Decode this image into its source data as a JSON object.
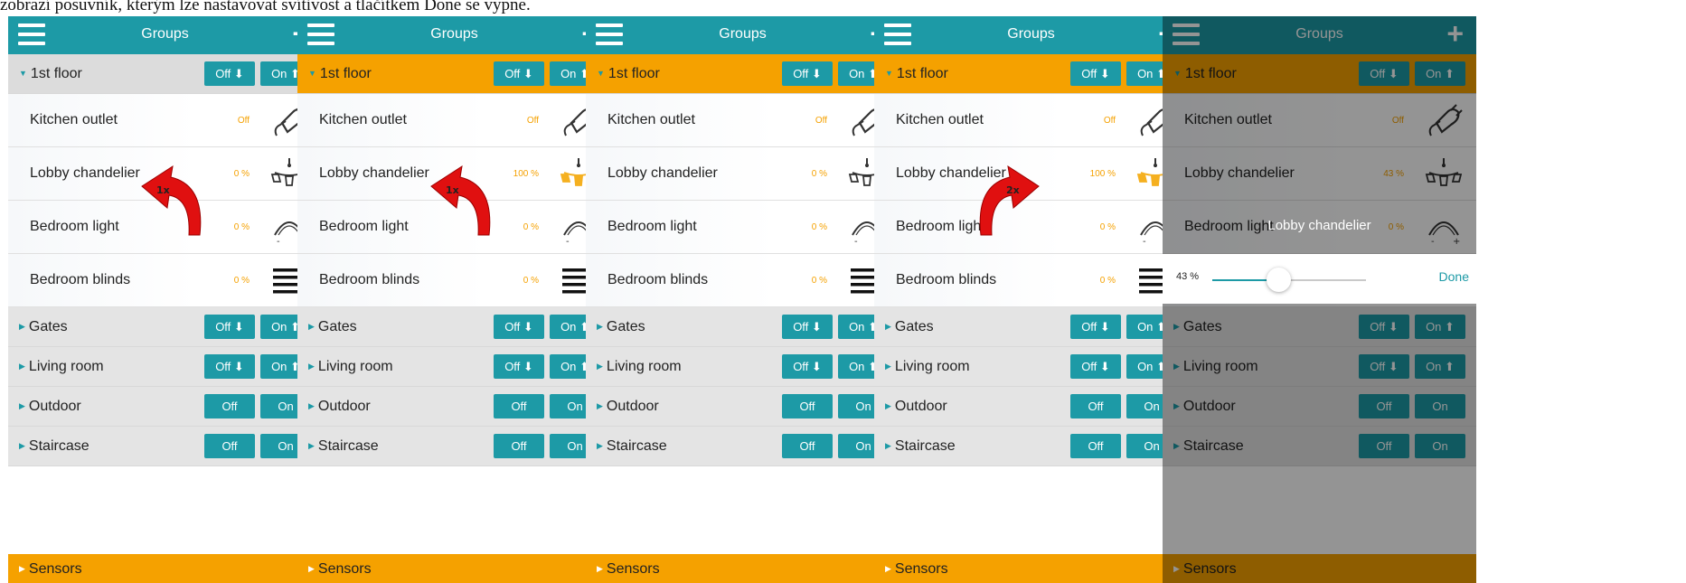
{
  "caption": "zobrazí posuvník, kterým lze nastavovat svítivost a tlačítkem Done se vypne.",
  "header": {
    "title": "Groups"
  },
  "colors": {
    "teal": "#1d9aa6",
    "orange": "#f5a100",
    "grey": "#e4e4e4"
  },
  "groups": {
    "first_floor": "1st floor",
    "gates": "Gates",
    "living_room": "Living room",
    "outdoor": "Outdoor",
    "staircase": "Staircase",
    "sensors": "Sensors"
  },
  "buttons": {
    "off_arrow": "Off ⬇",
    "on_arrow": "On ⬆",
    "off": "Off",
    "on": "On"
  },
  "devices": {
    "kitchen_outlet": "Kitchen outlet",
    "lobby_chandelier": "Lobby chandelier",
    "bedroom_light": "Bedroom light",
    "bedroom_blinds": "Bedroom blinds"
  },
  "panels": [
    {
      "kitchen": "Off",
      "lobby": "0 %",
      "bedroom_light": "0 %",
      "blinds": "0 %",
      "gesture": "1x",
      "lobby_level": 0
    },
    {
      "kitchen": "Off",
      "lobby": "100 %",
      "bedroom_light": "0 %",
      "blinds": "0 %",
      "gesture": "1x",
      "lobby_level": 1
    },
    {
      "kitchen": "Off",
      "lobby": "0 %",
      "bedroom_light": "0 %",
      "blinds": "0 %",
      "gesture": "",
      "lobby_level": 0
    },
    {
      "kitchen": "Off",
      "lobby": "100 %",
      "bedroom_light": "0 %",
      "blinds": "0 %",
      "gesture": "2x",
      "lobby_level": 1
    },
    {
      "kitchen": "Off",
      "lobby": "43 %",
      "bedroom_light": "0 %",
      "blinds": "0 %",
      "gesture": "",
      "lobby_level": 0.43
    }
  ],
  "slider": {
    "title": "Lobby chandelier",
    "value_text": "43 %",
    "level": 0.43,
    "done_label": "Done"
  },
  "icons": [
    "menu-icon",
    "plus-icon",
    "plug-icon",
    "chandelier-icon",
    "arc-light-icon",
    "blinds-icon",
    "red-curved-arrow-icon"
  ]
}
